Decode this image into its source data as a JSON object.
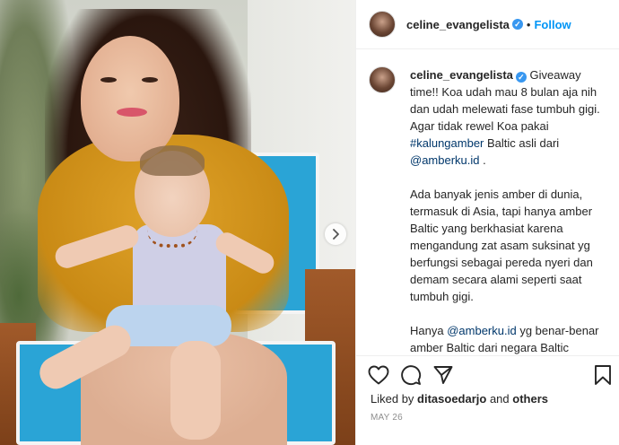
{
  "post": {
    "username": "celine_evangelista",
    "verified_glyph": "✓",
    "dot": "•",
    "follow_label": "Follow"
  },
  "caption": {
    "username": "celine_evangelista",
    "p1_a": "Giveaway time!! Koa udah mau 8 bulan aja nih dan udah melewati fase tumbuh gigi. Agar tidak rewel Koa pakai ",
    "hashtag": "#kalungamber",
    "p1_b": " Baltic asli dari ",
    "mention1": "@amberku.id",
    "p1_c": " .",
    "p2": "Ada banyak jenis amber di dunia, termasuk di Asia, tapi hanya amber Baltic yang berkhasiat karena mengandung zat asam suksinat yg berfungsi sebagai pereda nyeri dan demam secara alami seperti saat tumbuh gigi.",
    "p3_a": "Hanya ",
    "mention2": "@amberku.id",
    "p3_b": " yg benar-benar amber Baltic dari negara Baltic Lithuania karena sdh dites keasliannya oleh otoritas resmi di sana yaitu Lithuanian Assay Office. Bukti tes keaslian disertakan lho di pembelian"
  },
  "likes": {
    "prefix": "Liked by ",
    "user": "ditasoedarjo",
    "middle": " and ",
    "others": "others"
  },
  "date": "MAY 26",
  "icons": {
    "like": "heart-icon",
    "comment": "comment-icon",
    "share": "share-icon",
    "save": "bookmark-icon",
    "next": "chevron-right-icon"
  },
  "colors": {
    "link": "#00376b",
    "follow": "#0095f6",
    "verified": "#3897f0",
    "muted": "#8e8e8e"
  }
}
